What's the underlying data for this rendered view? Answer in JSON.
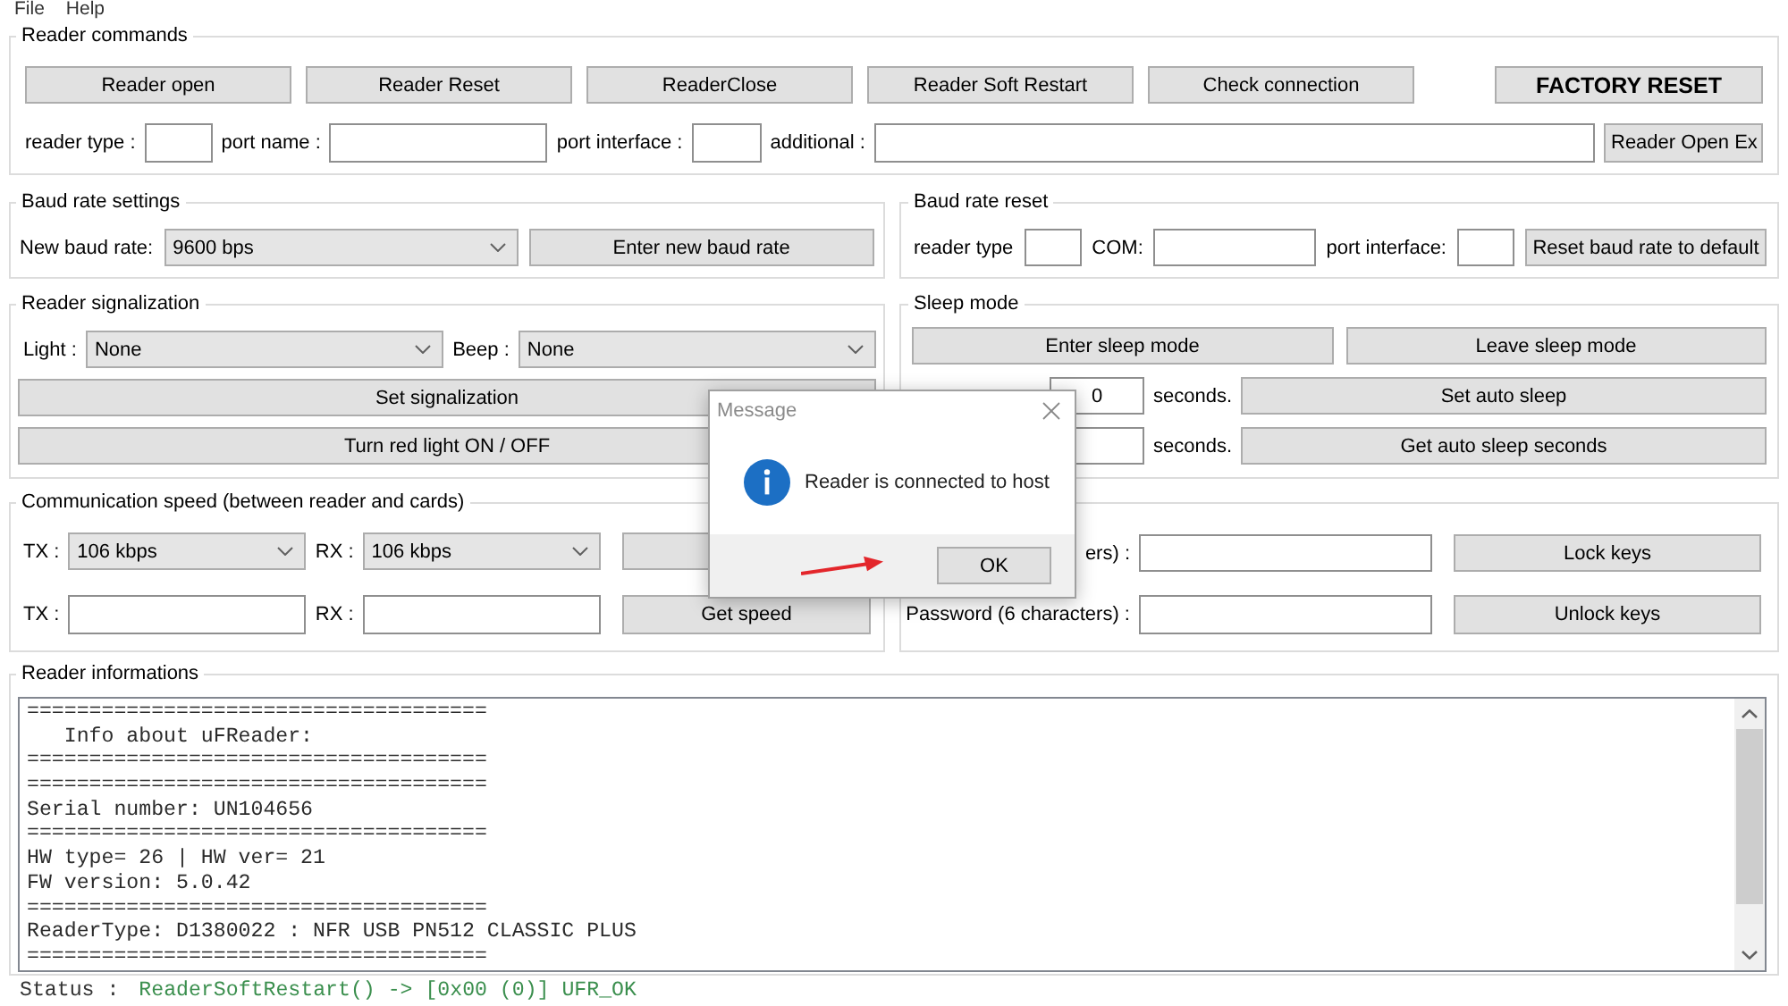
{
  "menu": [
    {
      "label": "File"
    },
    {
      "label": "Help"
    }
  ],
  "reader_commands": {
    "title": "Reader commands",
    "buttons": [
      {
        "label": "Reader open",
        "kind": "standard"
      },
      {
        "label": "Reader Reset",
        "kind": "standard"
      },
      {
        "label": "ReaderClose",
        "kind": "standard"
      },
      {
        "label": "Reader Soft Restart",
        "kind": "standard"
      },
      {
        "label": "Check connection",
        "kind": "standard"
      },
      {
        "label": "FACTORY RESET",
        "kind": "emphasized"
      }
    ],
    "fields": [
      {
        "label": "reader type :"
      },
      {
        "label": "port name :"
      },
      {
        "label": "port interface :"
      },
      {
        "label": "additional :"
      }
    ],
    "open_button": "Reader Open Ex"
  },
  "baud_rate_settings": {
    "title": "Baud rate settings",
    "label": "New baud rate:",
    "dropdown": "9600 bps",
    "button": "Enter new baud rate"
  },
  "baud_rate_reset": {
    "title": "Baud rate reset",
    "fields": [
      {
        "label": "reader type"
      },
      {
        "label": "COM:"
      },
      {
        "label": "port interface:"
      }
    ],
    "button": "Reset baud rate to default"
  },
  "reader_signalization": {
    "title": "Reader signalization",
    "dropdowns": [
      {
        "label": "Light :",
        "value": "None"
      },
      {
        "label": "Beep :",
        "value": "None"
      }
    ],
    "buttons": [
      "Set signalization",
      "Turn red light ON / OFF"
    ]
  },
  "sleep_mode": {
    "title": "Sleep mode",
    "buttons": [
      "Enter sleep mode",
      "Leave sleep mode"
    ],
    "rows": [
      {
        "value": "0",
        "unit": "seconds.",
        "button": "Set auto sleep"
      },
      {
        "unit": "seconds.",
        "button": "Get auto sleep seconds"
      }
    ]
  },
  "communication_speed": {
    "title": "Communication speed (between reader and cards)",
    "rows": [
      {
        "kind": "dropdowns",
        "tx_label": "TX :",
        "tx": "106 kbps",
        "rx_label": "RX :",
        "rx": "106 kbps"
      },
      {
        "kind": "fields",
        "tx_label": "TX :",
        "rx_label": "RX :",
        "button": "Get speed"
      }
    ]
  },
  "key_lock": {
    "rows": [
      {
        "label": "ers) :",
        "button": "Lock keys"
      },
      {
        "label": "Password (6 characters) :",
        "button": "Unlock keys"
      }
    ]
  },
  "reader_informations": {
    "title": "Reader informations",
    "lines": [
      "=====================================",
      "   Info about uFReader:",
      "=====================================",
      "=====================================",
      "Serial number: UN104656",
      "=====================================",
      "HW type= 26 | HW ver= 21",
      "FW version: 5.0.42",
      "=====================================",
      "ReaderType: D1380022 : NFR USB PN512 CLASSIC PLUS",
      "====================================="
    ]
  },
  "status": {
    "label": "Status :",
    "text": "ReaderSoftRestart() -> [0x00 (0)] UFR_OK"
  },
  "dialog": {
    "title": "Message",
    "message": "Reader is connected to host",
    "button": "OK"
  }
}
